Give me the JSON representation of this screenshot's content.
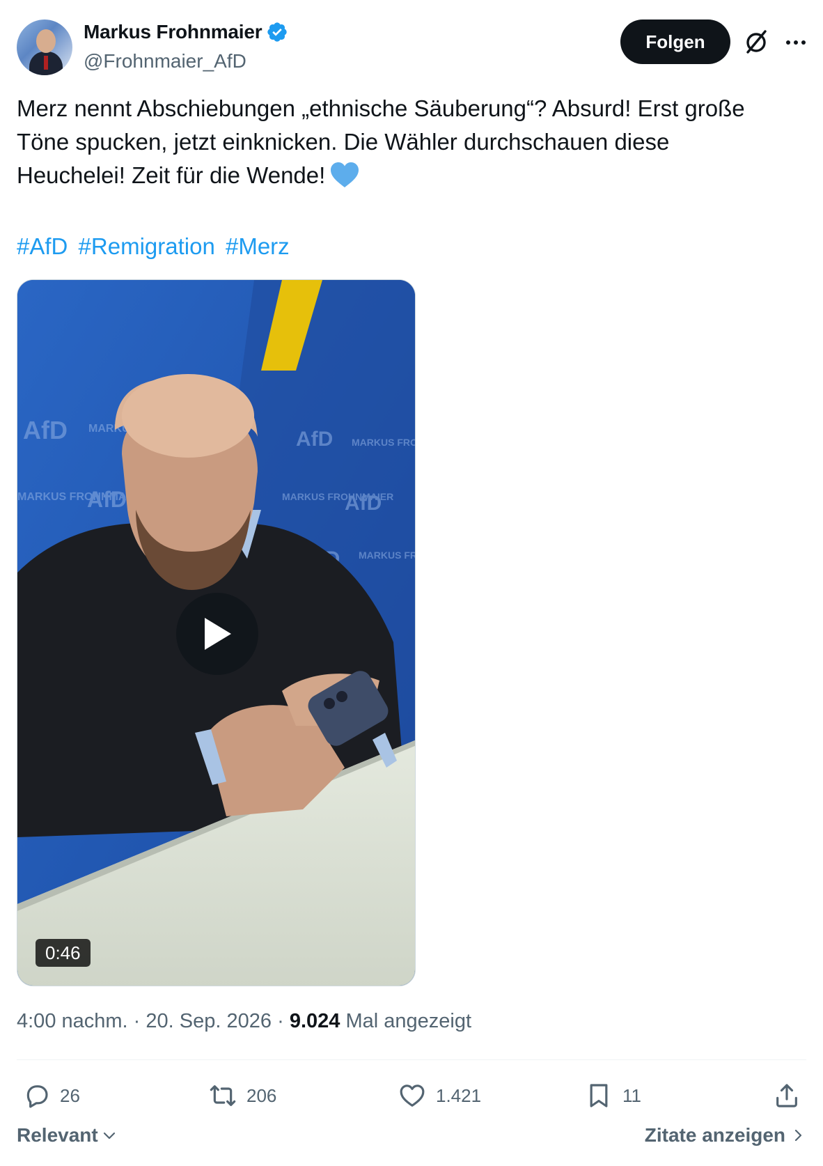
{
  "author": {
    "display_name": "Markus Frohnmaier",
    "handle": "@Frohnmaier_AfD",
    "verified": true,
    "avatar_icon": "profile-photo"
  },
  "header": {
    "follow_label": "Folgen",
    "grok_icon": "grok-icon",
    "more_icon": "more-dots-icon"
  },
  "tweet": {
    "text_line1": "Merz nennt Abschiebungen „ethnische Säuberung“? Absurd! Erst große",
    "text_line2": "Töne spucken, jetzt einknicken. Die Wähler durchschauen diese",
    "text_line3": "Heuchelei! Zeit für die Wende!",
    "emoji": "blue-heart",
    "hashtags": [
      "#AfD",
      "#Remigration",
      "#Merz"
    ]
  },
  "media": {
    "type": "video",
    "duration": "0:46",
    "backdrop_texts": [
      "AfD",
      "MARKUS FROHNMAIER"
    ]
  },
  "meta": {
    "time": "4:00 nachm.",
    "separator": "·",
    "date": "20. Sep. 2026",
    "views_count": "9.024",
    "views_label": "Mal angezeigt"
  },
  "actions": {
    "replies": "26",
    "reposts": "206",
    "likes": "1.421",
    "bookmarks": "11"
  },
  "footer": {
    "sort_label": "Relevant",
    "quotes_label": "Zitate anzeigen"
  },
  "colors": {
    "accent": "#1d9bf0",
    "text_primary": "#0f1419",
    "text_secondary": "#536471",
    "border": "#eff3f4",
    "video_backdrop": "#1d4fa8",
    "afd_yellow": "#e6c00b"
  }
}
